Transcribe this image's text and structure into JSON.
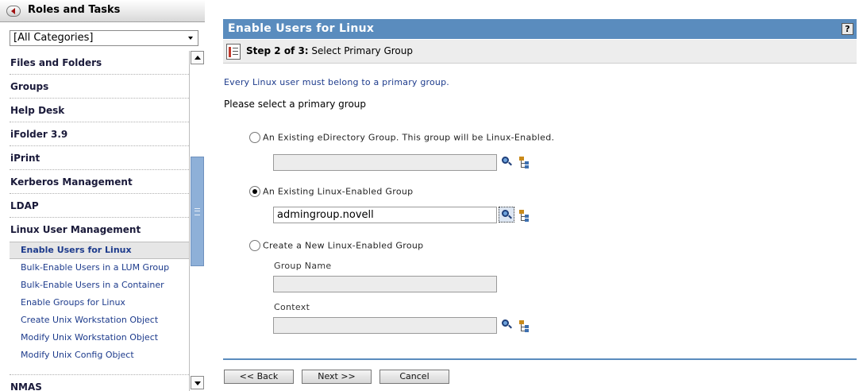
{
  "sidebar": {
    "title": "Roles and Tasks",
    "category_select": "[All Categories]",
    "groups_top": [
      {
        "label": "Files and Folders"
      },
      {
        "label": "Groups"
      },
      {
        "label": "Help Desk"
      },
      {
        "label": "iFolder 3.9"
      },
      {
        "label": "iPrint"
      },
      {
        "label": "Kerberos Management"
      },
      {
        "label": "LDAP"
      },
      {
        "label": "Linux User Management"
      }
    ],
    "sub_items": [
      {
        "label": "Enable Users for Linux",
        "active": true
      },
      {
        "label": "Bulk-Enable Users in a LUM Group"
      },
      {
        "label": "Bulk-Enable Users in a Container"
      },
      {
        "label": "Enable Groups for Linux"
      },
      {
        "label": "Create Unix Workstation Object"
      },
      {
        "label": "Modify Unix Workstation Object"
      },
      {
        "label": "Modify Unix Config Object"
      }
    ],
    "groups_bottom": [
      {
        "label": "NMAS"
      }
    ]
  },
  "main": {
    "title": "Enable Users for Linux",
    "help": "?",
    "step_bold": "Step 2 of 3:",
    "step_text": " Select Primary Group",
    "intro": "Every Linux user must belong to a primary group.",
    "prompt": "Please select a primary group",
    "options": {
      "existing_edir": {
        "label": "An Existing eDirectory Group. This group will be Linux-Enabled.",
        "selected": false,
        "value": ""
      },
      "existing_linux": {
        "label": "An Existing Linux-Enabled Group",
        "selected": true,
        "value": "admingroup.novell"
      },
      "create_new": {
        "label": "Create a New Linux-Enabled Group",
        "selected": false,
        "group_name_label": "Group Name",
        "group_name_value": "",
        "context_label": "Context",
        "context_value": ""
      }
    },
    "buttons": {
      "back": "<< Back",
      "next": "Next >>",
      "cancel": "Cancel"
    }
  }
}
